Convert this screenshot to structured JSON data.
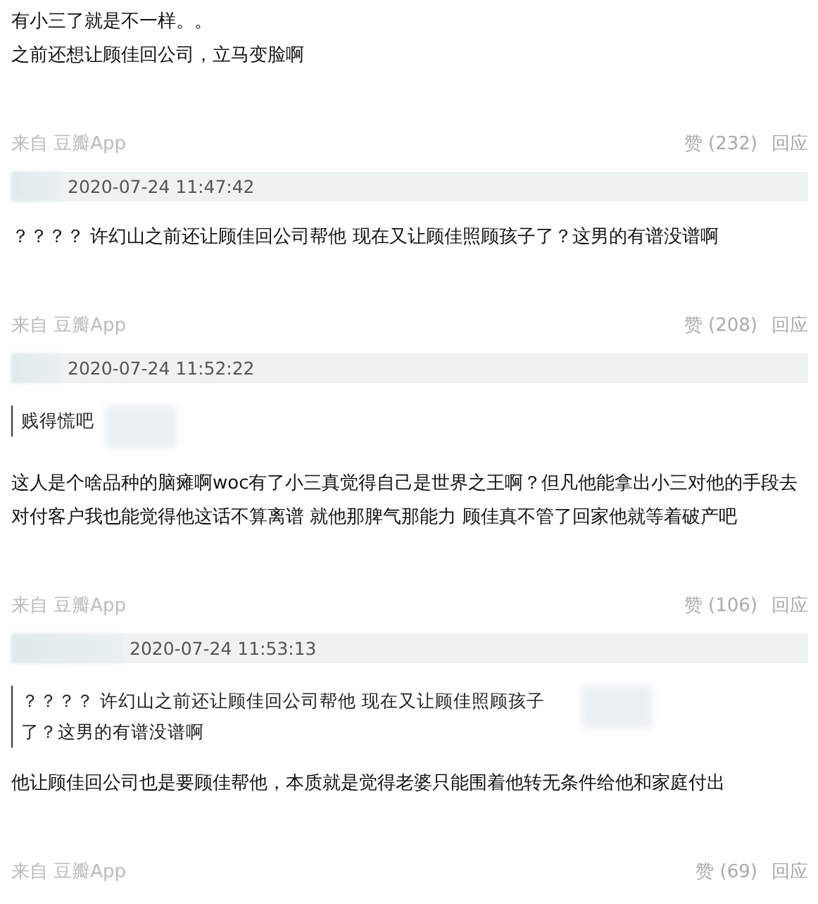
{
  "comments": [
    {
      "text": [
        "有小三了就是不一样。。",
        "之前还想让顾佳回公司，立马变脸啊"
      ],
      "source": "来自 豆瓣App",
      "likes": "赞 (232)",
      "reply": "回应"
    },
    {
      "date": "2020-07-24 11:47:42",
      "text": [
        "？？？？ 许幻山之前还让顾佳回公司帮他 现在又让顾佳照顾孩子了？这男的有谱没谱啊"
      ],
      "source": "来自 豆瓣App",
      "likes": "赞 (208)",
      "reply": "回应"
    },
    {
      "date": "2020-07-24 11:52:22",
      "quote": "贱得慌吧",
      "text": [
        "这人是个啥品种的脑瘫啊woc有了小三真觉得自己是世界之王啊？但凡他能拿出小三对他的手段去对付客户我也能觉得他这话不算离谱 就他那脾气那能力 顾佳真不管了回家他就等着破产吧"
      ],
      "source": "来自 豆瓣App",
      "likes": "赞 (106)",
      "reply": "回应"
    },
    {
      "date": "2020-07-24 11:53:13",
      "quote": "？？？？ 许幻山之前还让顾佳回公司帮他 现在又让顾佳照顾孩子了？这男的有谱没谱啊",
      "text": [
        "他让顾佳回公司也是要顾佳帮他，本质就是觉得老婆只能围着他转无条件给他和家庭付出"
      ],
      "source": "来自 豆瓣App",
      "likes": "赞 (69)",
      "reply": "回应"
    }
  ]
}
